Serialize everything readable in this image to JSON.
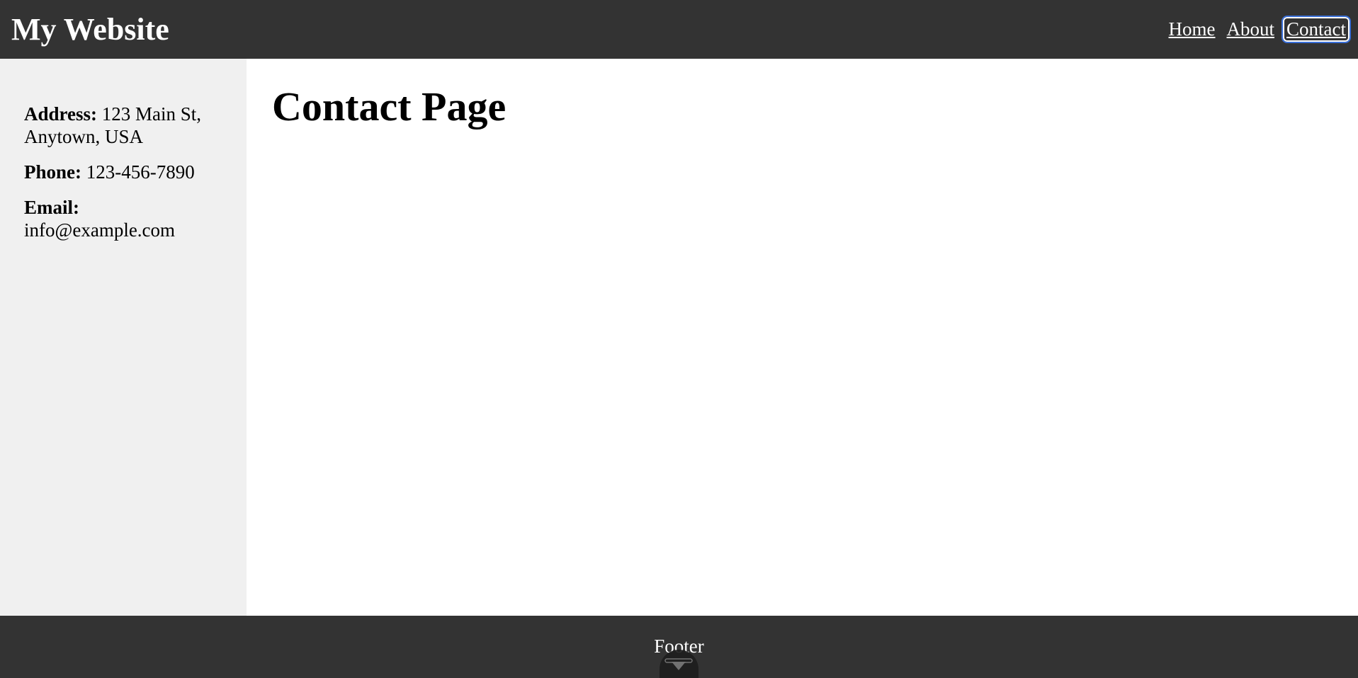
{
  "header": {
    "title": "My Website",
    "nav": [
      "Home",
      "About",
      "Contact"
    ],
    "active_nav": "Contact"
  },
  "sidebar": {
    "address_label": "Address:",
    "address_value": "123 Main St, Anytown, USA",
    "phone_label": "Phone:",
    "phone_value": "123-456-7890",
    "email_label": "Email:",
    "email_value": "info@example.com"
  },
  "main": {
    "title": "Contact Page"
  },
  "footer": {
    "text": "Footer"
  },
  "colors": {
    "header_bg": "#333333",
    "sidebar_bg": "#f0f0f0",
    "focus_ring": "#3a6fd8"
  },
  "icons": {
    "scroll_handle": "chevron-down-icon"
  }
}
